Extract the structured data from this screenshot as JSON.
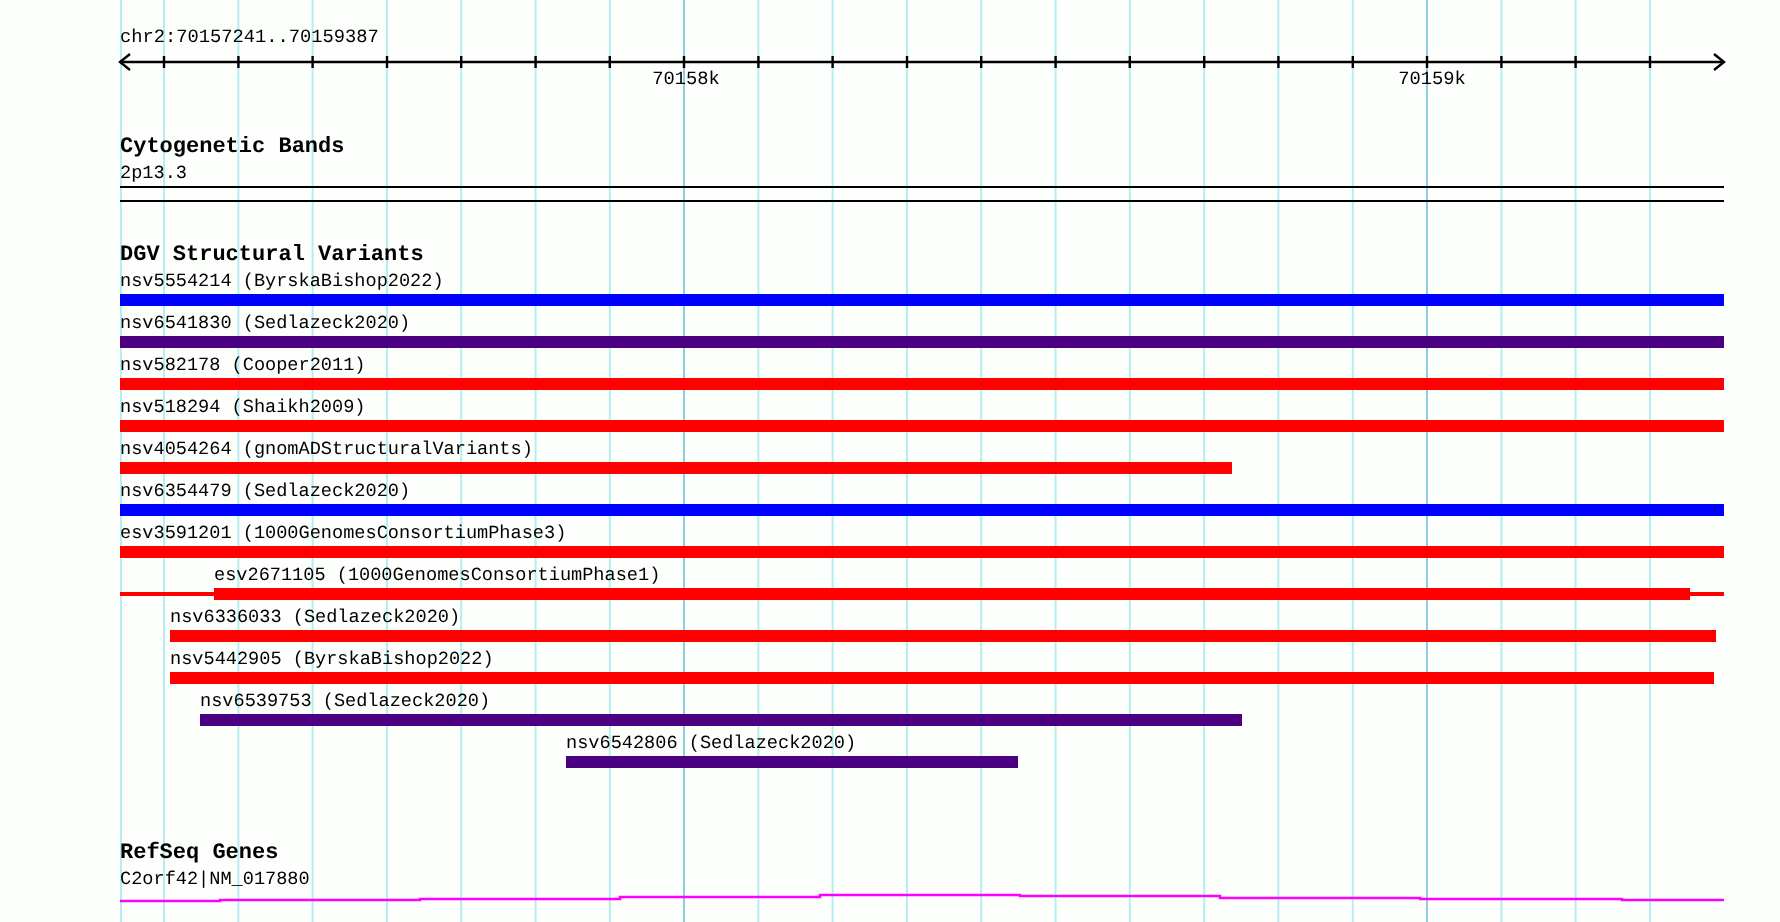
{
  "ruler": {
    "position": "chr2:70157241..70159387",
    "ticks": [
      "70158k",
      "70159k"
    ]
  },
  "tracks": [
    {
      "kind": "bands",
      "title": "Cytogenetic Bands",
      "items": [
        {
          "label": "2p13.3"
        }
      ]
    },
    {
      "kind": "variants",
      "title": "DGV Structural Variants",
      "items": [
        {
          "label": "nsv5554214 (ByrskaBishop2022)",
          "color": "#0000ff"
        },
        {
          "label": "nsv6541830 (Sedlazeck2020)",
          "color": "#4b0082"
        },
        {
          "label": "nsv582178 (Cooper2011)",
          "color": "#ff0000"
        },
        {
          "label": "nsv518294 (Shaikh2009)",
          "color": "#ff0000"
        },
        {
          "label": "nsv4054264 (gnomADStructuralVariants)",
          "color": "#ff0000"
        },
        {
          "label": "nsv6354479 (Sedlazeck2020)",
          "color": "#0000ff"
        },
        {
          "label": "esv3591201 (1000GenomesConsortiumPhase3)",
          "color": "#ff0000"
        },
        {
          "label": "esv2671105 (1000GenomesConsortiumPhase1)",
          "color": "#ff0000"
        },
        {
          "label": "nsv6336033 (Sedlazeck2020)",
          "color": "#ff0000"
        },
        {
          "label": "nsv5442905 (ByrskaBishop2022)",
          "color": "#ff0000"
        },
        {
          "label": "nsv6539753 (Sedlazeck2020)",
          "color": "#4b0082"
        },
        {
          "label": "nsv6542806 (Sedlazeck2020)",
          "color": "#4b0082"
        }
      ]
    },
    {
      "kind": "genes",
      "title": "RefSeq Genes",
      "items": [
        {
          "label": "C2orf42|NM_017880"
        }
      ]
    }
  ]
}
